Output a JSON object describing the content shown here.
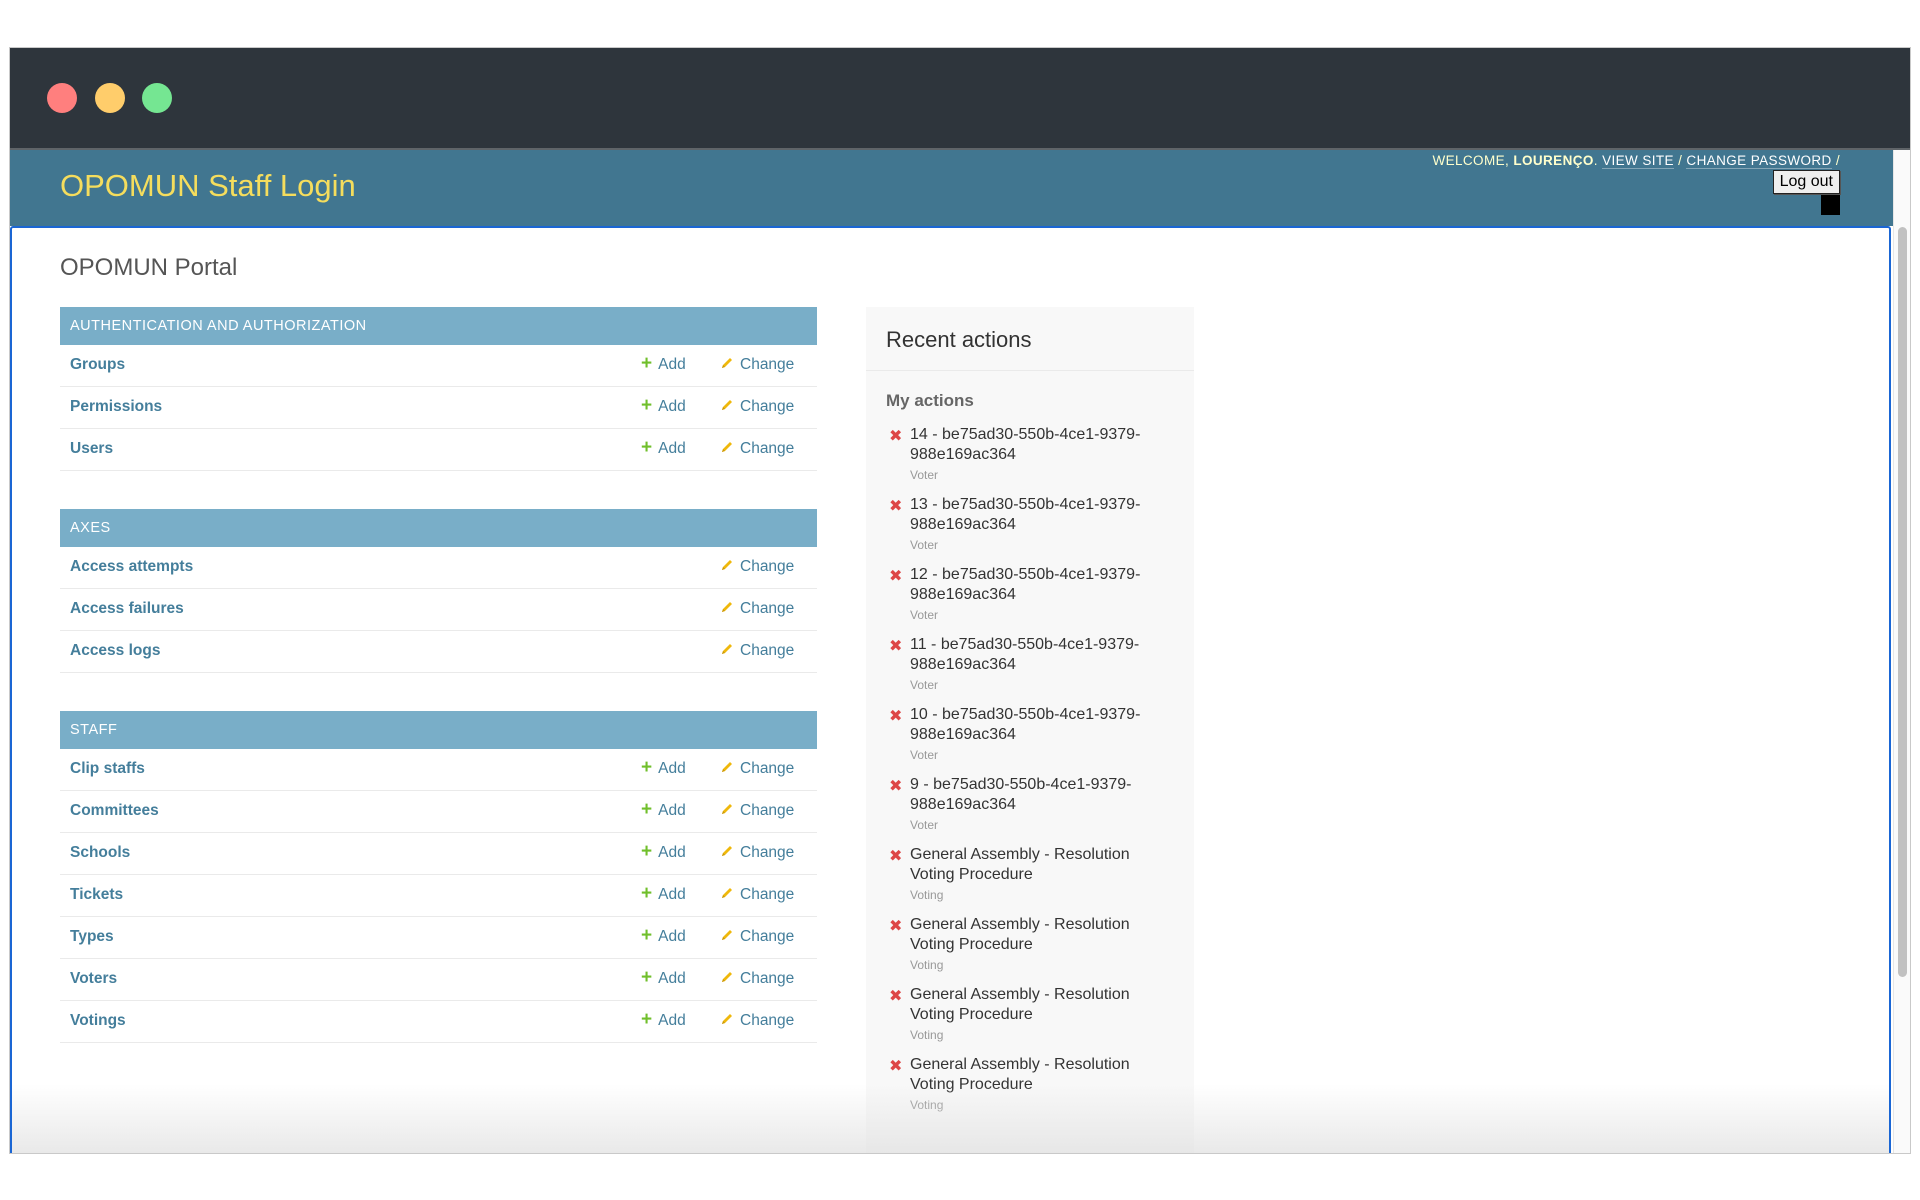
{
  "window": {
    "traffic_lights": [
      "close",
      "minimize",
      "maximize"
    ]
  },
  "header": {
    "branding": "OPOMUN Staff Login",
    "welcome_prefix": "Welcome,",
    "username": "Lourenço",
    "after_username": ".",
    "view_site": "View site",
    "separator": "/",
    "change_password": "Change password",
    "trailing_separator": "/",
    "logout_label": "Log out"
  },
  "page": {
    "title": "OPOMUN Portal"
  },
  "modules": [
    {
      "name": "Authentication and Authorization",
      "models": [
        {
          "name": "Groups",
          "add": "Add",
          "change": "Change"
        },
        {
          "name": "Permissions",
          "add": "Add",
          "change": "Change"
        },
        {
          "name": "Users",
          "add": "Add",
          "change": "Change"
        }
      ]
    },
    {
      "name": "Axes",
      "models": [
        {
          "name": "Access attempts",
          "add": null,
          "change": "Change"
        },
        {
          "name": "Access failures",
          "add": null,
          "change": "Change"
        },
        {
          "name": "Access logs",
          "add": null,
          "change": "Change"
        }
      ]
    },
    {
      "name": "Staff",
      "models": [
        {
          "name": "Clip staffs",
          "add": "Add",
          "change": "Change"
        },
        {
          "name": "Committees",
          "add": "Add",
          "change": "Change"
        },
        {
          "name": "Schools",
          "add": "Add",
          "change": "Change"
        },
        {
          "name": "Tickets",
          "add": "Add",
          "change": "Change"
        },
        {
          "name": "Types",
          "add": "Add",
          "change": "Change"
        },
        {
          "name": "Voters",
          "add": "Add",
          "change": "Change"
        },
        {
          "name": "Votings",
          "add": "Add",
          "change": "Change"
        }
      ]
    }
  ],
  "recent_actions": {
    "title": "Recent actions",
    "subtitle": "My actions",
    "items": [
      {
        "icon": "delete-icon",
        "title": "14 - be75ad30-550b-4ce1-9379-988e169ac364",
        "type": "Voter"
      },
      {
        "icon": "delete-icon",
        "title": "13 - be75ad30-550b-4ce1-9379-988e169ac364",
        "type": "Voter"
      },
      {
        "icon": "delete-icon",
        "title": "12 - be75ad30-550b-4ce1-9379-988e169ac364",
        "type": "Voter"
      },
      {
        "icon": "delete-icon",
        "title": "11 - be75ad30-550b-4ce1-9379-988e169ac364",
        "type": "Voter"
      },
      {
        "icon": "delete-icon",
        "title": "10 - be75ad30-550b-4ce1-9379-988e169ac364",
        "type": "Voter"
      },
      {
        "icon": "delete-icon",
        "title": "9 - be75ad30-550b-4ce1-9379-988e169ac364",
        "type": "Voter"
      },
      {
        "icon": "delete-icon",
        "title": "General Assembly - Resolution Voting Procedure",
        "type": "Voting"
      },
      {
        "icon": "delete-icon",
        "title": "General Assembly - Resolution Voting Procedure",
        "type": "Voting"
      },
      {
        "icon": "delete-icon",
        "title": "General Assembly - Resolution Voting Procedure",
        "type": "Voting"
      },
      {
        "icon": "delete-icon",
        "title": "General Assembly - Resolution Voting Procedure",
        "type": "Voting"
      }
    ]
  },
  "colors": {
    "header_bg": "#417690",
    "branding": "#f5dd5d",
    "module_header": "#79aec8",
    "link": "#447e9b",
    "add_icon": "#70bf2b",
    "change_icon": "#efb80b",
    "delete_icon": "#dd4646"
  }
}
